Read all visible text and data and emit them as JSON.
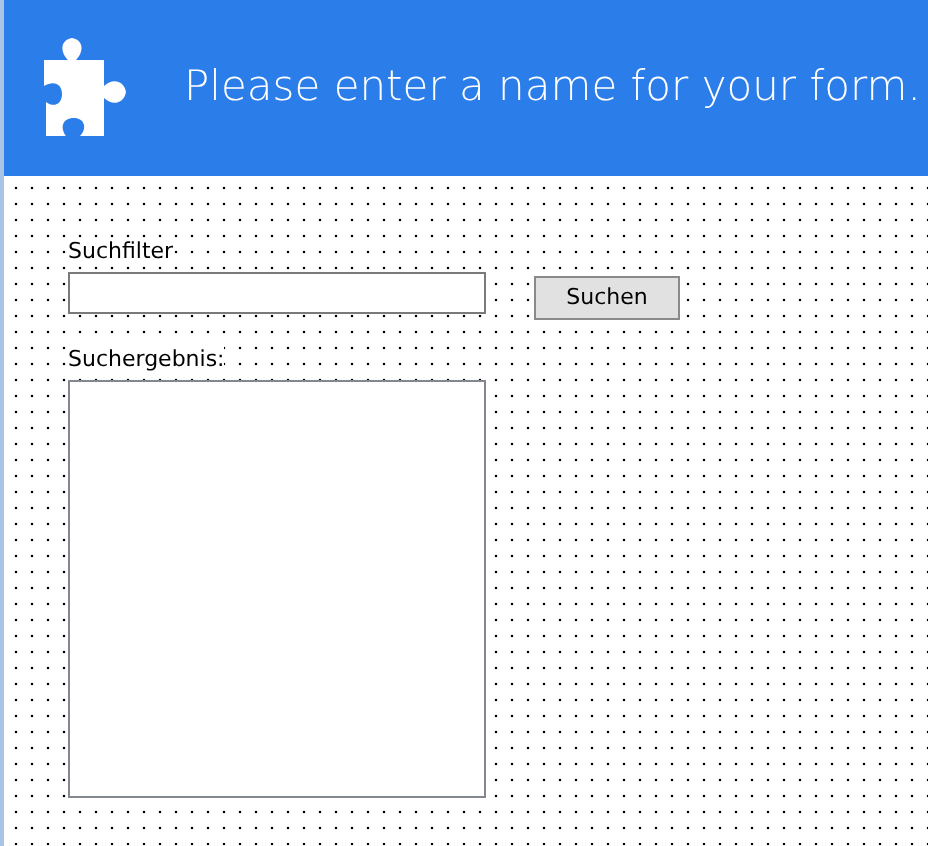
{
  "header": {
    "title": "Please enter a name for your form."
  },
  "search_filter": {
    "label": "Suchfilter",
    "button": "Suchen"
  },
  "search_result": {
    "label": "Suchergebnis:"
  }
}
